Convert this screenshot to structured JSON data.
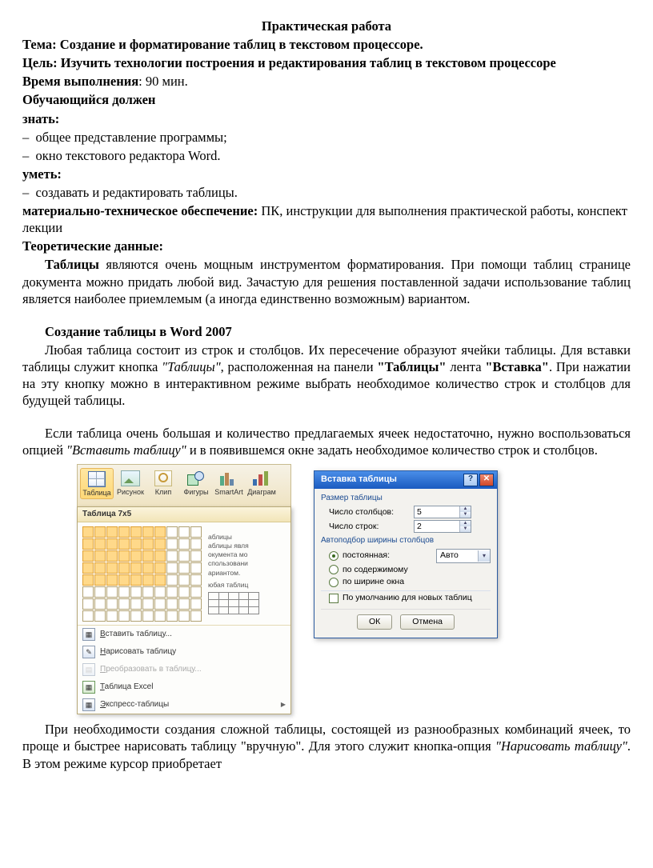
{
  "title": "Практическая работа",
  "topic_label": "Тема:",
  "topic": "Создание и форматирование таблиц в текстовом процессоре.",
  "goal_label": "Цель:",
  "goal": "Изучить технологии построения и редактирования таблиц в текстовом процессоре",
  "time_label": "Время выполнения",
  "time_value": ": 90 мин.",
  "learner_heading": "Обучающийся должен",
  "know_label": "знать:",
  "know_items": [
    "общее представление программы;",
    "окно текстового редактора Word."
  ],
  "can_label": "уметь:",
  "can_items": [
    "создавать и редактировать таблицы."
  ],
  "resources_label": "материально-техническое обеспечение:",
  "resources": " ПК, инструкции для выполнения практической работы, конспект лекции",
  "theory_label": "Теоретические данные:",
  "p1_a": "Таблицы",
  "p1_b": " являются очень мощным инструментом форматирования. При помощи таблиц странице документа можно придать любой вид. Зачастую для решения поставленной задачи использование таблиц является наиболее приемлемым (а иногда единственно возможным) вариантом.",
  "h2": "Создание таблицы в Word 2007",
  "p2_a": "Любая таблица состоит из строк и столбцов. Их пересечение образуют ячейки таблицы. Для вставки таблицы служит кнопка ",
  "p2_b": "\"Таблицы\"",
  "p2_c": ", расположенная на  панели ",
  "p2_d": "\"Таблицы\"",
  "p2_e": " лента ",
  "p2_f": "\"Вставка\"",
  "p2_g": ". При нажатии на эту кнопку можно в интерактивном режиме выбрать необходимое количество строк и столбцов для будущей таблицы.",
  "p3_a": "Если таблица очень большая и количество предлагаемых ячеек недостаточно, нужно воспользоваться опцией ",
  "p3_b": "\"Вставить таблицу\"",
  "p3_c": " и в появившемся окне задать необходимое количество строк и столбцов.",
  "p4_a": "При необходимости создания сложной таблицы, состоящей из разнообразных комбинаций ячеек, то проще и быстрее нарисовать таблицу \"вручную\". Для этого служит кнопка-опция ",
  "p4_b": "\"Нарисовать таблицу\"",
  "p4_c": ". В этом режиме курсор приобретает",
  "ribbon": {
    "buttons": [
      "Таблица",
      "Рисунок",
      "Клип",
      "Фигуры",
      "SmartArt",
      "Диаграм"
    ],
    "flyout_header": "Таблица 7x5",
    "selected_cols": 7,
    "selected_rows": 5,
    "doc_lines": [
      "аблицы",
      "аблицы явля",
      "окумента мо",
      "спользовани",
      "ариантом.",
      "юбая таблиц"
    ],
    "menu": [
      "Вставить таблицу...",
      "Нарисовать таблицу",
      "Преобразовать в таблицу...",
      "Таблица Excel",
      "Экспресс-таблицы"
    ]
  },
  "dialog": {
    "title": "Вставка таблицы",
    "group1": "Размер таблицы",
    "cols_label": "Число столбцов:",
    "cols_value": "5",
    "rows_label": "Число строк:",
    "rows_value": "2",
    "group2": "Автоподбор ширины столбцов",
    "r1": "постоянная:",
    "r1_val": "Авто",
    "r2": "по содержимому",
    "r3": "по ширине окна",
    "chk": "По умолчанию для новых таблиц",
    "ok": "ОК",
    "cancel": "Отмена"
  }
}
